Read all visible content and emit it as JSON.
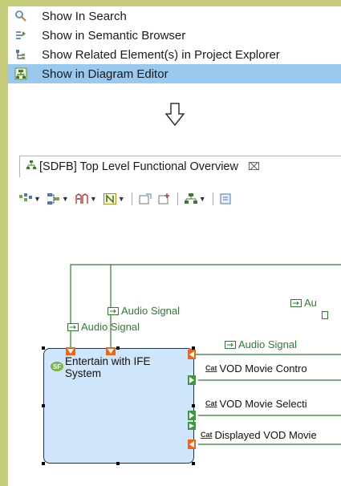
{
  "menu": {
    "items": [
      {
        "label": "Show In Search",
        "icon": "search-icon"
      },
      {
        "label": "Show in Semantic Browser",
        "icon": "semantic-browser-icon"
      },
      {
        "label": "Show Related Element(s) in Project Explorer",
        "icon": "project-explorer-icon"
      },
      {
        "label": "Show in Diagram Editor",
        "icon": "diagram-editor-icon",
        "selected": true
      }
    ]
  },
  "editor": {
    "tab_title": "[SDFB] Top Level Functional Overview",
    "close_glyph": "⌧"
  },
  "diagram": {
    "ports": {
      "audio1": "Audio Signal",
      "audio2": "Audio Signal",
      "audio3": "Audio Signal",
      "audio_partial": "Au"
    },
    "function": {
      "badge": "SF",
      "name": "Entertain with IFE System"
    },
    "exchanges": [
      {
        "tag": "Cat",
        "label": "VOD Movie Contro"
      },
      {
        "tag": "Cat",
        "label": "VOD Movie Selecti"
      },
      {
        "tag": "Cat",
        "label": "Displayed VOD Movie"
      }
    ]
  },
  "colors": {
    "selection": "#99c9ef",
    "outer_frame": "#c5cc7a",
    "function_fill": "#cfe5fb",
    "link_green": "#2e7d32",
    "port_orange": "#e8671b"
  }
}
